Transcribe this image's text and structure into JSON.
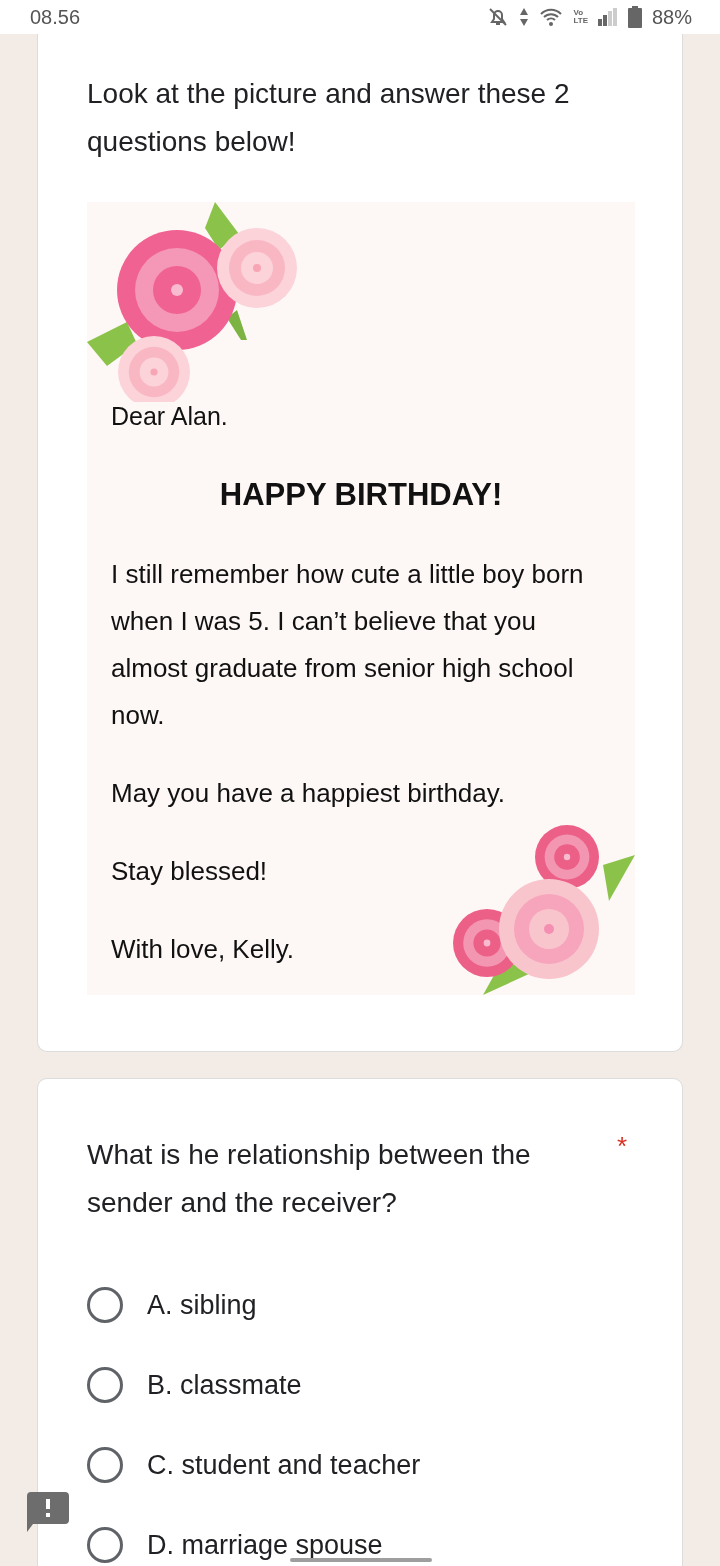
{
  "status_bar": {
    "time": "08.56",
    "network": [
      "Vo",
      "LTE"
    ],
    "battery": "88%"
  },
  "intro": {
    "title": "Look at the picture and answer these 2 questions below!"
  },
  "card_image": {
    "greeting": "Dear Alan.",
    "heading": "HAPPY BIRTHDAY!",
    "paragraphs": [
      "I still remember how cute a little boy born when I was 5. I can’t believe that you almost graduate from senior high school now.",
      "May you have a happiest birthday.",
      "Stay blessed!",
      "With love, Kelly."
    ]
  },
  "question": {
    "text": "What is he relationship between the sender and the receiver?",
    "required_mark": "*",
    "options": [
      {
        "label": "A. sibling",
        "selected": false
      },
      {
        "label": "B. classmate",
        "selected": false
      },
      {
        "label": "C. student and teacher",
        "selected": false
      },
      {
        "label": "D. marriage spouse",
        "selected": false
      }
    ]
  }
}
